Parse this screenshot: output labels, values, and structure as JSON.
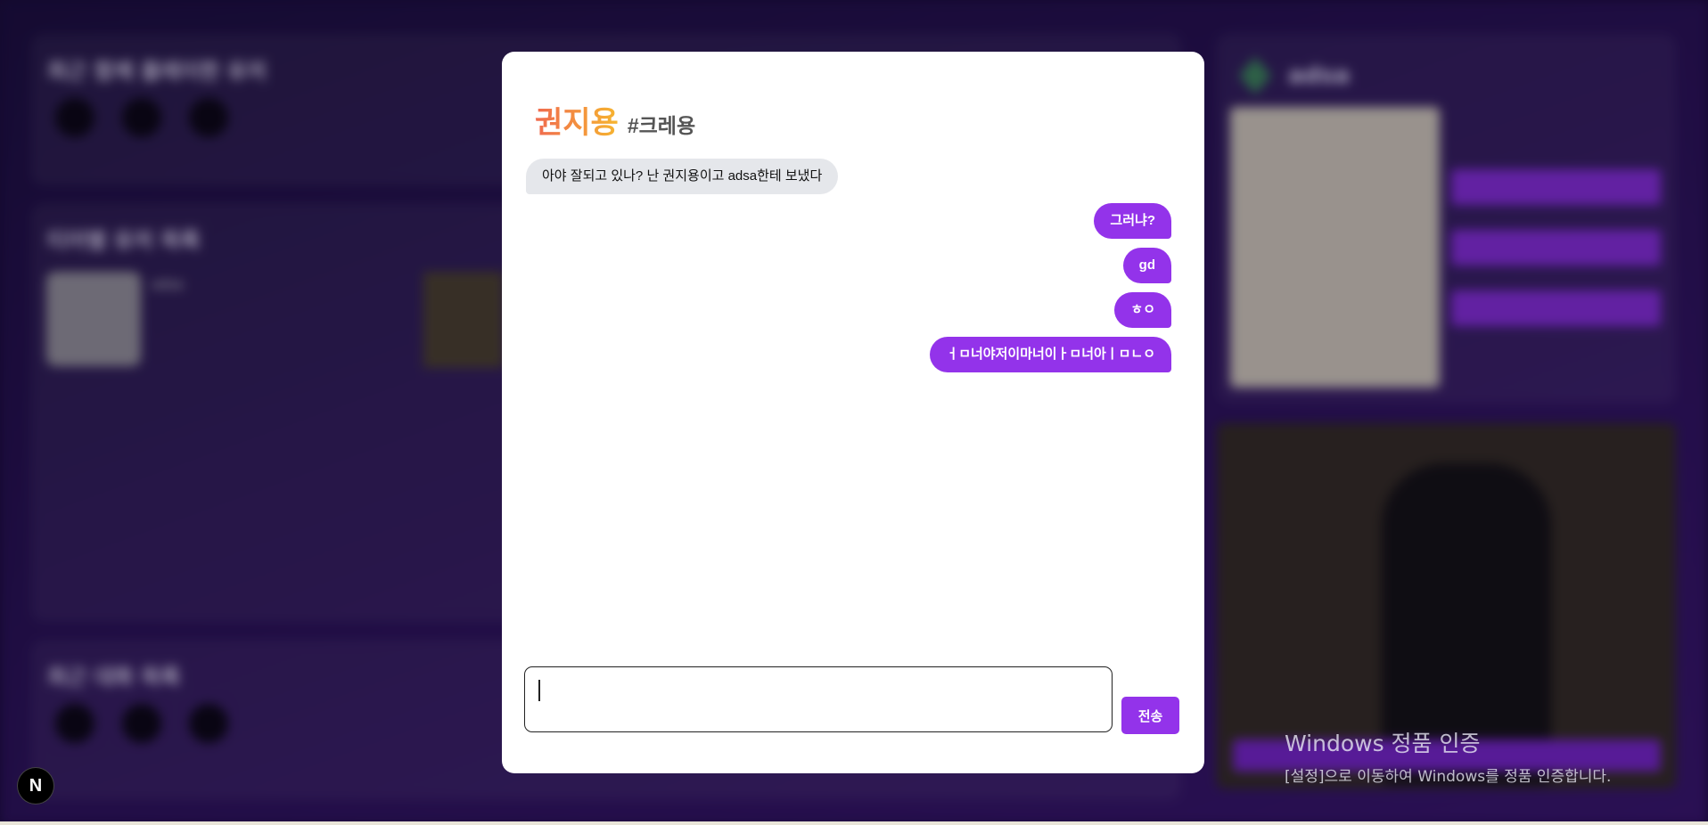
{
  "background": {
    "recent_music_title": "최근 함께 플레이한 유저",
    "friends_title": "티어별 유저 목록",
    "recent_chat_title": "최근 대화 목록",
    "user_name": "adsa",
    "video_title": "권지용 #크레용"
  },
  "chat": {
    "name": "권지용",
    "tag": "#크레용",
    "messages": [
      {
        "direction": "received",
        "text": "아야 잘되고 있나? 난 권지용이고 adsa한테 보냈다"
      },
      {
        "direction": "sent",
        "text": "그러냐?"
      },
      {
        "direction": "sent",
        "text": "gd"
      },
      {
        "direction": "sent",
        "text": "ㅎㅇ"
      },
      {
        "direction": "sent",
        "text": "ㅓㅁ너야저이마너이ㅏㅁ너아ㅣㅁㄴㅇ"
      }
    ],
    "input_value": "",
    "send_label": "전송"
  },
  "watermark": {
    "title": "Windows 정품 인증",
    "subtitle": "[설정]으로 이동하여 Windows를 정품 인증합니다."
  },
  "next_badge": "N",
  "colors": {
    "accent": "#9333ea",
    "received_bubble": "#e5e7eb",
    "name_gradient_start": "#f06a4f",
    "name_gradient_end": "#f6b52f"
  }
}
